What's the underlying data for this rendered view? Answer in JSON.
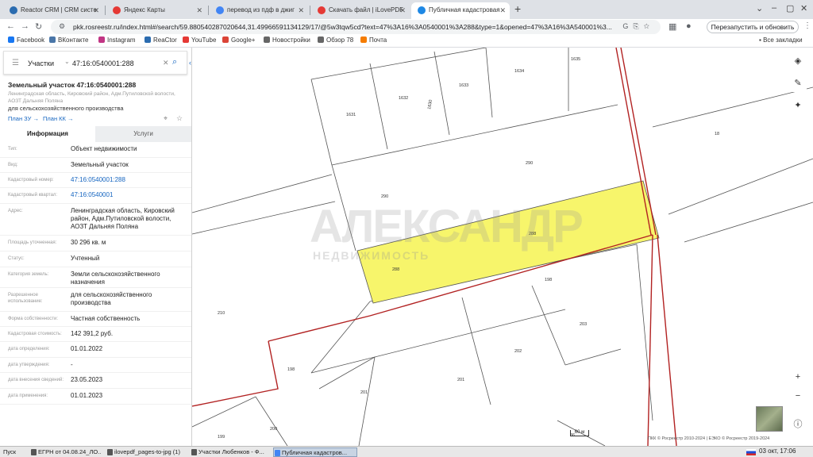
{
  "browser": {
    "tabs": [
      {
        "label": "Reactor CRM | CRM систе",
        "fav_color": "#2b6cb0"
      },
      {
        "label": "Яндекс Карты",
        "fav_color": "#e53935"
      },
      {
        "label": "перевод из пдф в джиг",
        "fav_color": "#4285f4"
      },
      {
        "label": "Скачать файл | iLovePDF",
        "fav_color": "#e53935"
      },
      {
        "label": "Публичная кадастровая",
        "fav_color": "#1e88e5"
      }
    ],
    "new_tab": "+",
    "window_controls": [
      "⌄",
      "–",
      "▢",
      "✕"
    ],
    "url": "pkk.rosreestr.ru/index.html#/search/59.880540287020644,31.49966591134129/17/@5w3tqw5cd?text=47%3A16%3A0540001%3A288&type=1&opened=47%3A16%3A540001%3...",
    "restart_button": "Перезапустить и обновить",
    "bookmarks": [
      {
        "label": "Facebook",
        "color": "#1877f2"
      },
      {
        "label": "ВКонтакте",
        "color": "#4a76a8"
      },
      {
        "label": "Instagram",
        "color": "#c13584"
      },
      {
        "label": "ReaCtor",
        "color": "#2b6cb0"
      },
      {
        "label": "YouTube",
        "color": "#e53935"
      },
      {
        "label": "Google+",
        "color": "#db4437"
      },
      {
        "label": "Новостройки",
        "color": "#666666"
      },
      {
        "label": "Обзор 78",
        "color": "#666666"
      },
      {
        "label": "Почта",
        "color": "#f57c00"
      }
    ],
    "all_bookmarks": "Все закладки"
  },
  "search": {
    "mode": "Участки",
    "query": "47:16:0540001:288"
  },
  "parcel": {
    "title": "Земельный участок 47:16:0540001:288",
    "address_short": "Ленинградская область, Кировский район, Адм.Путиловской волости, АОЗТ Дальняя Поляна",
    "use": "для сельскохозяйственного производства",
    "plan_zu": "План ЗУ →",
    "plan_kk": "План КК →"
  },
  "panel_tabs": {
    "info": "Информация",
    "services": "Услуги"
  },
  "info_rows": [
    {
      "label": "Тип:",
      "value": "Объект недвижимости",
      "link": false
    },
    {
      "label": "Вид:",
      "value": "Земельный участок",
      "link": false
    },
    {
      "label": "Кадастровый номер:",
      "value": "47:16:0540001:288",
      "link": true
    },
    {
      "label": "Кадастровый квартал:",
      "value": "47:16:0540001",
      "link": true
    },
    {
      "label": "Адрес:",
      "value": "Ленинградская область, Кировский район, Адм.Путиловской волости, АОЗТ Дальняя Поляна",
      "link": false
    },
    {
      "label": "Площадь уточненная:",
      "value": "30 296 кв. м",
      "link": false
    },
    {
      "label": "Статус:",
      "value": "Учтенный",
      "link": false
    },
    {
      "label": "Категория земель:",
      "value": "Земли сельскохозяйственного назначения",
      "link": false
    },
    {
      "label": "Разрешенное использование:",
      "value": "для сельскохозяйственного производства",
      "link": false
    },
    {
      "label": "Форма собственности:",
      "value": "Частная собственность",
      "link": false
    },
    {
      "label": "Кадастровая стоимость:",
      "value": "142 391,2 руб.",
      "link": false
    },
    {
      "label": "дата определения:",
      "value": "01.01.2022",
      "link": false
    },
    {
      "label": "дата утверждения:",
      "value": "-",
      "link": false
    },
    {
      "label": "дата внесения сведений:",
      "value": "23.05.2023",
      "link": false
    },
    {
      "label": "дата применения:",
      "value": "01.01.2023",
      "link": false
    }
  ],
  "map": {
    "parcel_labels": [
      "1635",
      "1634",
      "1633",
      "1632",
      "1631",
      "1630",
      "18",
      "290",
      "290",
      "288",
      "288",
      "198",
      "210",
      "203",
      "202",
      "201",
      "201",
      "198",
      "200",
      "199",
      "36"
    ],
    "watermark": "АЛЕКСАНДР",
    "watermark_sub": "НЕДВИЖИМОСТЬ",
    "scale": "60 м",
    "attribution": "ПКК © Росреестр 2010-2024 | ЕЭКО © Росреестр 2019-2024",
    "highlight_color": "#f7f56b",
    "boundary_color": "#b22222"
  },
  "taskbar": {
    "start": "Пуск",
    "items": [
      "ЕГРН от 04.08.24_ЛО...",
      "ilovepdf_pages-to-jpg (1)",
      "Участки Любенков - Ф...",
      "Публичная кадастров..."
    ],
    "clock": "03 окт, 17:06"
  }
}
